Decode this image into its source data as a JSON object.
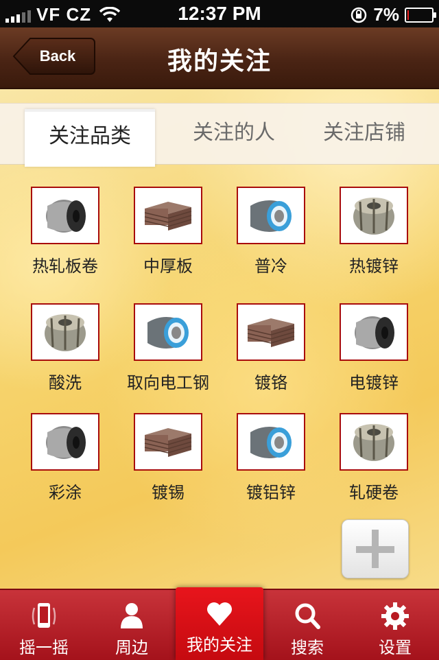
{
  "status_bar": {
    "carrier": "VF CZ",
    "time": "12:37 PM",
    "battery_percent": "7%",
    "battery_level": 0.07
  },
  "nav": {
    "back_label": "Back",
    "title": "我的关注"
  },
  "tabs": [
    {
      "label": "关注品类",
      "active": true
    },
    {
      "label": "关注的人",
      "active": false
    },
    {
      "label": "关注店铺",
      "active": false
    }
  ],
  "categories": [
    {
      "label": "热轧板卷",
      "icon": "dark-coil-icon"
    },
    {
      "label": "中厚板",
      "icon": "plate-stack-icon"
    },
    {
      "label": "普冷",
      "icon": "blue-coil-icon"
    },
    {
      "label": "热镀锌",
      "icon": "banded-coil-icon"
    },
    {
      "label": "酸洗",
      "icon": "banded-coil-icon"
    },
    {
      "label": "取向电工钢",
      "icon": "blue-coil-icon"
    },
    {
      "label": "镀铬",
      "icon": "plate-stack-icon"
    },
    {
      "label": "电镀锌",
      "icon": "dark-coil-icon"
    },
    {
      "label": "彩涂",
      "icon": "dark-coil-icon"
    },
    {
      "label": "镀锡",
      "icon": "plate-stack-icon"
    },
    {
      "label": "镀铝锌",
      "icon": "blue-coil-icon"
    },
    {
      "label": "轧硬卷",
      "icon": "banded-coil-icon"
    }
  ],
  "tabbar": [
    {
      "label": "摇一摇",
      "icon": "phone-shake-icon",
      "active": false
    },
    {
      "label": "周边",
      "icon": "person-icon",
      "active": false
    },
    {
      "label": "我的关注",
      "icon": "heart-icon",
      "active": true
    },
    {
      "label": "搜索",
      "icon": "search-icon",
      "active": false
    },
    {
      "label": "设置",
      "icon": "gear-icon",
      "active": false
    }
  ],
  "colors": {
    "nav_brown": "#4a2414",
    "tabbar_red": "#a4121b",
    "active_red": "#e8151c",
    "thumb_border": "#a80c0c"
  }
}
